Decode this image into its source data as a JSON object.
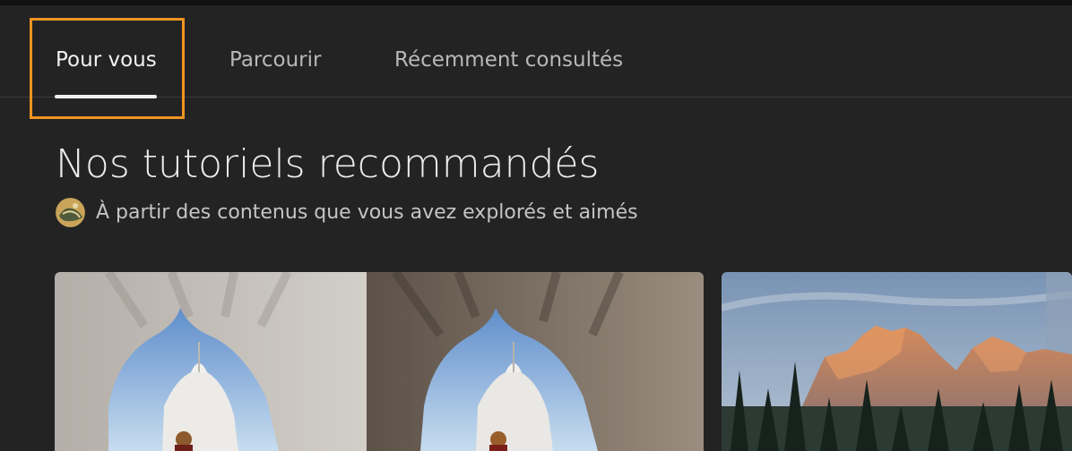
{
  "tabs": [
    {
      "label": "Pour vous",
      "active": true
    },
    {
      "label": "Parcourir",
      "active": false
    },
    {
      "label": "Récemment consultés",
      "active": false
    }
  ],
  "section": {
    "title": "Nos tutoriels recommandés",
    "subtitle": "À partir des contenus que vous avez explorés et aimés"
  },
  "cards": [
    {
      "image": "before-after-temple-arch-photo"
    },
    {
      "image": "mountain-sunset-photo"
    }
  ],
  "colors": {
    "background": "#232323",
    "highlight": "#f29423"
  }
}
